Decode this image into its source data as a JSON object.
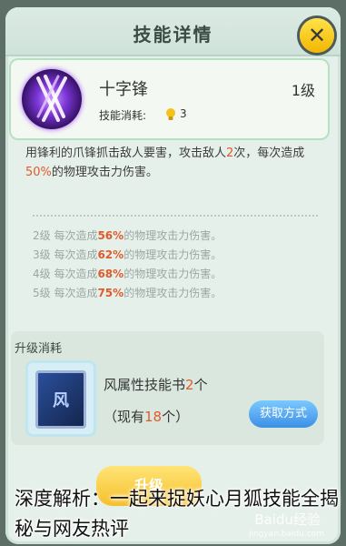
{
  "header": {
    "title": "技能详情",
    "close_label": "✕"
  },
  "skill": {
    "name": "十字锋",
    "cost_label": "技能消耗:",
    "cost_value": "3",
    "level": "1级",
    "desc_parts": [
      "用锋利的爪锋抓击敌人要害，攻击敌人",
      "2",
      "次，每次造成",
      "50%",
      "的物理攻击力伤害。"
    ]
  },
  "levels": [
    {
      "prefix": "2级 每次造成",
      "value": "56%",
      "suffix": "的物理攻击力伤害。"
    },
    {
      "prefix": "3级 每次造成",
      "value": "62%",
      "suffix": "的物理攻击力伤害。"
    },
    {
      "prefix": "4级 每次造成",
      "value": "68%",
      "suffix": "的物理攻击力伤害。"
    },
    {
      "prefix": "5级 每次造成",
      "value": "75%",
      "suffix": "的物理攻击力伤害。"
    }
  ],
  "upgrade": {
    "title": "升级消耗",
    "book_glyph": "风",
    "item_name": "风属性技能书",
    "item_count": "2",
    "item_unit": "个",
    "have_prefix": "（现有",
    "have_count": "18",
    "have_suffix": "个）",
    "obtain_label": "获取方式",
    "upgrade_label": "升级"
  },
  "overlay": {
    "caption": "深度解析：一起来捉妖心月狐技能全揭秘与网友热评"
  },
  "watermark": {
    "brand": "Baidu经验",
    "url": "jingyan.baidu.com"
  },
  "colors": {
    "accent": "#e05a2a",
    "close": "#f5c400",
    "obtain": "#3d8fe6"
  }
}
